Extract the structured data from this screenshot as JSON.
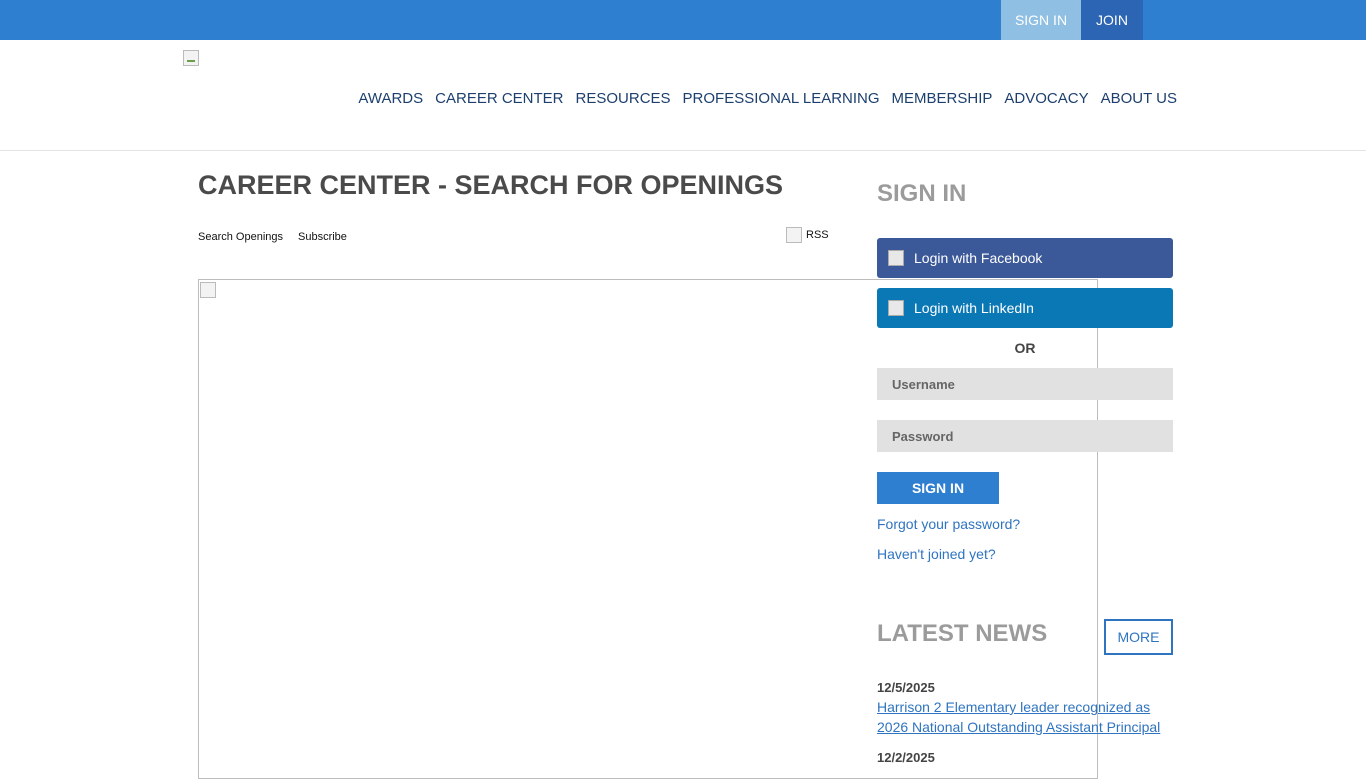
{
  "topbar": {
    "sign_in": "SIGN IN",
    "join": "JOIN"
  },
  "nav": {
    "items": [
      "AWARDS",
      "CAREER CENTER",
      "RESOURCES",
      "PROFESSIONAL LEARNING",
      "MEMBERSHIP",
      "ADVOCACY",
      "ABOUT US"
    ]
  },
  "main": {
    "title": "CAREER CENTER - SEARCH FOR OPENINGS",
    "subnav": [
      "Search Openings",
      "Subscribe"
    ],
    "rss": "RSS"
  },
  "sidebar": {
    "title": "SIGN IN",
    "facebook": "Login with Facebook",
    "linkedin": "Login with LinkedIn",
    "or": "OR",
    "username_placeholder": "Username",
    "password_placeholder": "Password",
    "sign_in_button": "SIGN IN",
    "forgot": "Forgot your password?",
    "not_joined": "Haven't joined yet?"
  },
  "news": {
    "title": "LATEST NEWS",
    "more": "MORE",
    "items": [
      {
        "date": "12/5/2025",
        "headline": "Harrison 2 Elementary leader recognized as 2026 National Outstanding Assistant Principal"
      },
      {
        "date": "12/2/2025",
        "headline": ""
      }
    ]
  },
  "colors": {
    "topbar": "#2f7fd0",
    "facebook": "#3b5898",
    "linkedin": "#0b78b6",
    "link": "#2f74c0"
  }
}
